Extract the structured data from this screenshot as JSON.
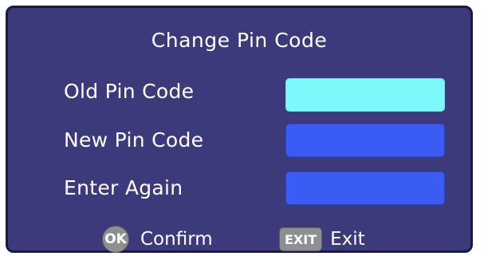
{
  "dialog": {
    "title": "Change Pin Code",
    "fields": [
      {
        "label": "Old Pin Code",
        "value": ""
      },
      {
        "label": "New Pin Code",
        "value": ""
      },
      {
        "label": "Enter Again",
        "value": ""
      }
    ]
  },
  "footer": {
    "ok_badge": "OK",
    "confirm_label": "Confirm",
    "exit_badge": "EXIT",
    "exit_label": "Exit"
  },
  "colors": {
    "dialog_background": "#3d3a7c",
    "active_field": "#7ef9fb",
    "inactive_field": "#3a5cf5",
    "badge": "#8d8f90"
  }
}
